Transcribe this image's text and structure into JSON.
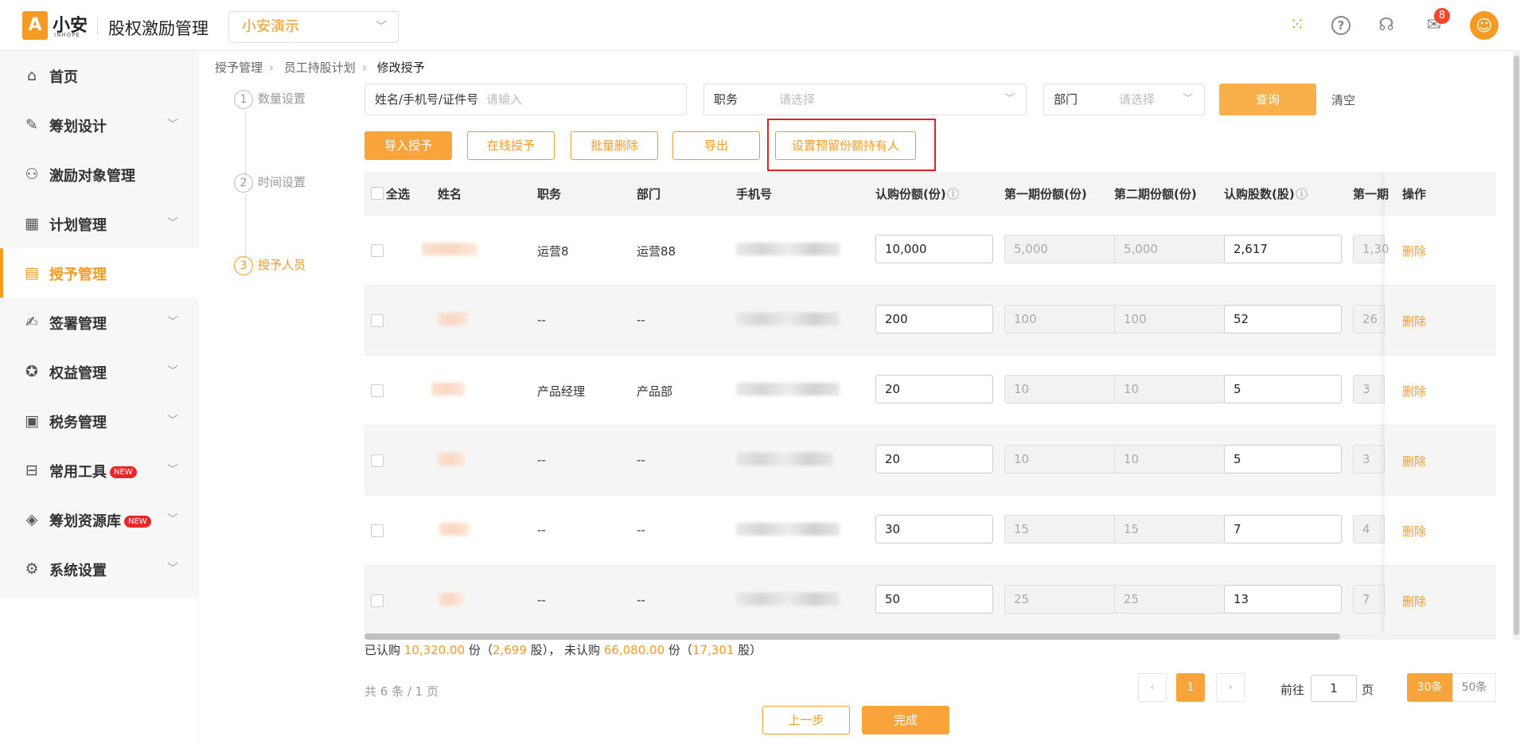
{
  "header": {
    "logo_text": "小安",
    "logo_sub": "INHOPE",
    "app_title": "股权激励管理",
    "company": "小安演示",
    "message_count": "8"
  },
  "sidebar": {
    "items": [
      {
        "label": "首页",
        "icon": "home-icon"
      },
      {
        "label": "筹划设计",
        "icon": "edit-icon"
      },
      {
        "label": "激励对象管理",
        "icon": "users-icon"
      },
      {
        "label": "计划管理",
        "icon": "apps-icon"
      },
      {
        "label": "授予管理",
        "icon": "book-icon",
        "active": true
      },
      {
        "label": "签署管理",
        "icon": "sign-icon"
      },
      {
        "label": "权益管理",
        "icon": "badge-icon"
      },
      {
        "label": "税务管理",
        "icon": "tax-icon"
      },
      {
        "label": "常用工具",
        "icon": "toolbox-icon",
        "badge": "NEW"
      },
      {
        "label": "筹划资源库",
        "icon": "layers-icon",
        "badge": "NEW"
      },
      {
        "label": "系统设置",
        "icon": "settings-icon"
      }
    ]
  },
  "breadcrumb": [
    "授予管理",
    "员工持股计划",
    "修改授予"
  ],
  "steps": [
    {
      "num": "1",
      "label": "数量设置"
    },
    {
      "num": "2",
      "label": "时间设置"
    },
    {
      "num": "3",
      "label": "授予人员",
      "active": true
    }
  ],
  "filters": {
    "name_label": "姓名/手机号/证件号",
    "name_placeholder": "请输入",
    "position_label": "职务",
    "position_placeholder": "请选择",
    "dept_label": "部门",
    "dept_placeholder": "请选择",
    "query": "查询",
    "clear": "清空"
  },
  "toolbar": {
    "import": "导入授予",
    "online": "在线授予",
    "batch_delete": "批量删除",
    "export": "导出",
    "set_reserved": "设置预留份额持有人"
  },
  "table": {
    "headers": {
      "select_all": "全选",
      "name": "姓名",
      "position": "职务",
      "dept": "部门",
      "phone": "手机号",
      "subscribe_units": "认购份额(份)",
      "phase1_units": "第一期份额(份)",
      "phase2_units": "第二期份额(份)",
      "subscribe_shares": "认购股数(股)",
      "phase1_shares": "第一期",
      "ops": "操作"
    },
    "rows": [
      {
        "position": "运营8",
        "dept": "运营88",
        "units": "10,000",
        "p1": "5,000",
        "p2": "5,000",
        "shares": "2,617",
        "p1s": "1,30",
        "op": "删除"
      },
      {
        "position": "--",
        "dept": "--",
        "units": "200",
        "p1": "100",
        "p2": "100",
        "shares": "52",
        "p1s": "26",
        "op": "删除"
      },
      {
        "position": "产品经理",
        "dept": "产品部",
        "units": "20",
        "p1": "10",
        "p2": "10",
        "shares": "5",
        "p1s": "3",
        "op": "删除"
      },
      {
        "position": "--",
        "dept": "--",
        "units": "20",
        "p1": "10",
        "p2": "10",
        "shares": "5",
        "p1s": "3",
        "op": "删除"
      },
      {
        "position": "--",
        "dept": "--",
        "units": "30",
        "p1": "15",
        "p2": "15",
        "shares": "7",
        "p1s": "4",
        "op": "删除"
      },
      {
        "position": "--",
        "dept": "--",
        "units": "50",
        "p1": "25",
        "p2": "25",
        "shares": "13",
        "p1s": "7",
        "op": "删除"
      }
    ]
  },
  "summary": {
    "subscribed_label": "已认购",
    "subscribed_units": "10,320.00",
    "unit_word": "份",
    "subscribed_shares": "2,699",
    "share_word": "股",
    "unsubscribed_label": "未认购",
    "unsubscribed_units": "66,080.00",
    "unsubscribed_shares": "17,301"
  },
  "pagination": {
    "total": "共 6 条 / 1 页",
    "current": "1",
    "goto_label": "前往",
    "goto_value": "1",
    "goto_suffix": "页",
    "size30": "30条",
    "size50": "50条"
  },
  "footer": {
    "prev": "上一步",
    "finish": "完成"
  },
  "colors": {
    "accent": "#f59a23",
    "highlight": "#e62020"
  }
}
